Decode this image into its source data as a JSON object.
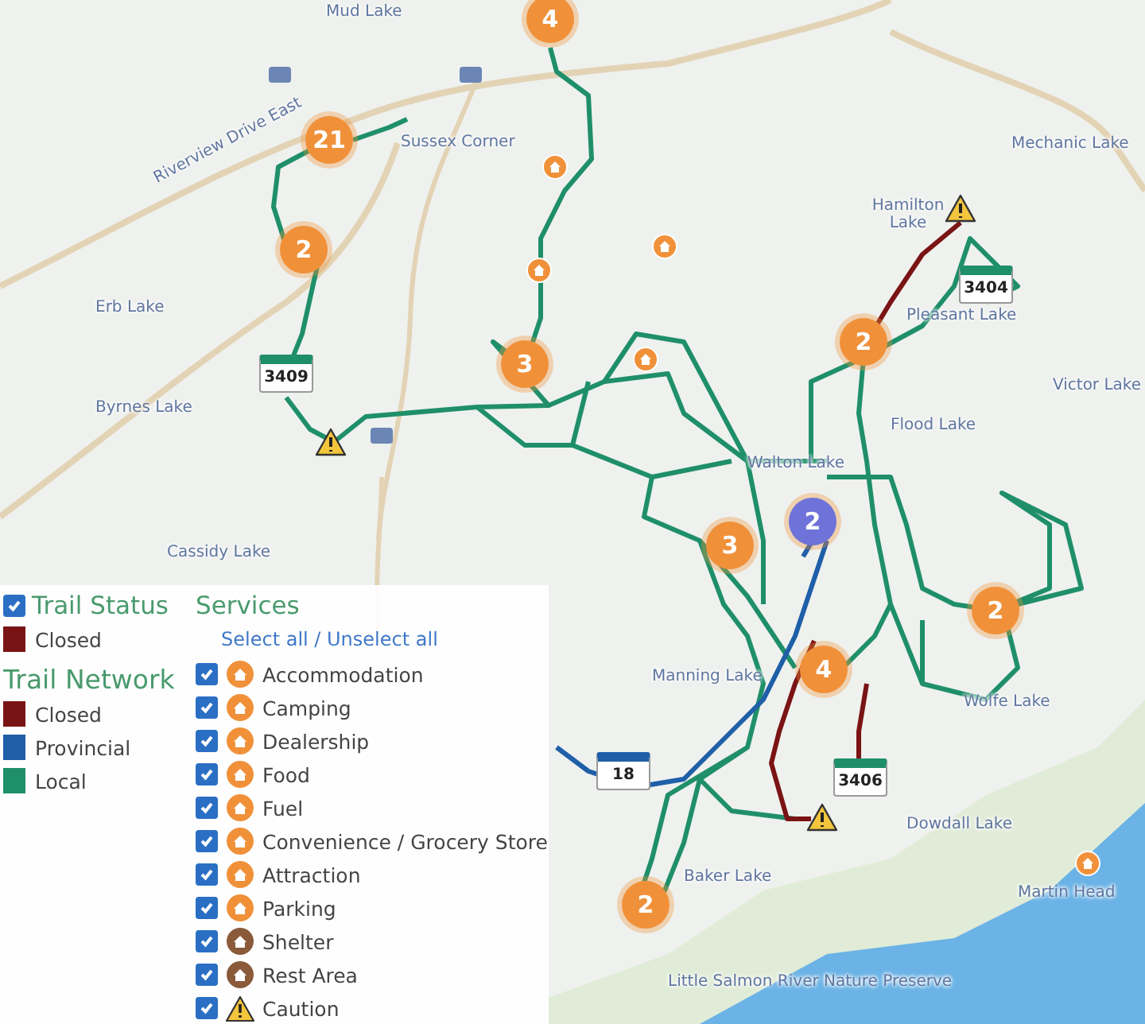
{
  "map": {
    "labels": [
      {
        "text": "Mud Lake"
      },
      {
        "text": "Riverview Drive East"
      },
      {
        "text": "Sussex Corner"
      },
      {
        "text": "Erb Lake"
      },
      {
        "text": "Byrnes Lake"
      },
      {
        "text": "Cassidy Lake"
      },
      {
        "text": "Mechanic Lake"
      },
      {
        "text": "Hamilton Lake"
      },
      {
        "text": "Pleasant Lake"
      },
      {
        "text": "Victor Lake"
      },
      {
        "text": "Flood Lake"
      },
      {
        "text": "Walton Lake"
      },
      {
        "text": "Manning Lake"
      },
      {
        "text": "Wolfe Lake"
      },
      {
        "text": "Dowdall Lake"
      },
      {
        "text": "Baker Lake"
      },
      {
        "text": "Little Salmon River Nature Preserve"
      },
      {
        "text": "Martin Head"
      }
    ],
    "clusters": [
      {
        "count": "4",
        "color": "#f0913a"
      },
      {
        "count": "21",
        "color": "#f0913a"
      },
      {
        "count": "2",
        "color": "#f0913a"
      },
      {
        "count": "3",
        "color": "#f0913a"
      },
      {
        "count": "2",
        "color": "#f0913a"
      },
      {
        "count": "3",
        "color": "#f0913a"
      },
      {
        "count": "2",
        "color": "#6f72d8"
      },
      {
        "count": "2",
        "color": "#f0913a"
      },
      {
        "count": "4",
        "color": "#f0913a"
      },
      {
        "count": "2",
        "color": "#f0913a"
      }
    ],
    "shields": [
      {
        "number": "3409",
        "kind": "local"
      },
      {
        "number": "3404",
        "kind": "local"
      },
      {
        "number": "18",
        "kind": "provincial"
      },
      {
        "number": "3406",
        "kind": "local"
      }
    ]
  },
  "legend": {
    "trail_status": {
      "title": "Trail Status",
      "checked": true,
      "items": [
        {
          "label": "Closed",
          "color": "#7a1414"
        }
      ]
    },
    "trail_network": {
      "title": "Trail Network",
      "items": [
        {
          "label": "Closed",
          "color": "#7a1414"
        },
        {
          "label": "Provincial",
          "color": "#1f5fa8"
        },
        {
          "label": "Local",
          "color": "#1f8f6a"
        }
      ]
    },
    "services": {
      "title": "Services",
      "select_link": "Select all / Unselect all",
      "items": [
        {
          "label": "Accommodation",
          "checked": true,
          "kind": "pin",
          "color": "#f0913a"
        },
        {
          "label": "Camping",
          "checked": true,
          "kind": "pin",
          "color": "#f0913a"
        },
        {
          "label": "Dealership",
          "checked": true,
          "kind": "pin",
          "color": "#f0913a"
        },
        {
          "label": "Food",
          "checked": true,
          "kind": "pin",
          "color": "#f0913a"
        },
        {
          "label": "Fuel",
          "checked": true,
          "kind": "pin",
          "color": "#f0913a"
        },
        {
          "label": "Convenience / Grocery Store",
          "checked": true,
          "kind": "pin",
          "color": "#f0913a"
        },
        {
          "label": "Attraction",
          "checked": true,
          "kind": "pin",
          "color": "#f0913a"
        },
        {
          "label": "Parking",
          "checked": true,
          "kind": "pin",
          "color": "#f0913a"
        },
        {
          "label": "Shelter",
          "checked": true,
          "kind": "pin",
          "color": "#8a5a3a"
        },
        {
          "label": "Rest Area",
          "checked": true,
          "kind": "pin",
          "color": "#8a5a3a"
        },
        {
          "label": "Caution",
          "checked": true,
          "kind": "warning",
          "color": "#f2c53d"
        }
      ]
    }
  }
}
